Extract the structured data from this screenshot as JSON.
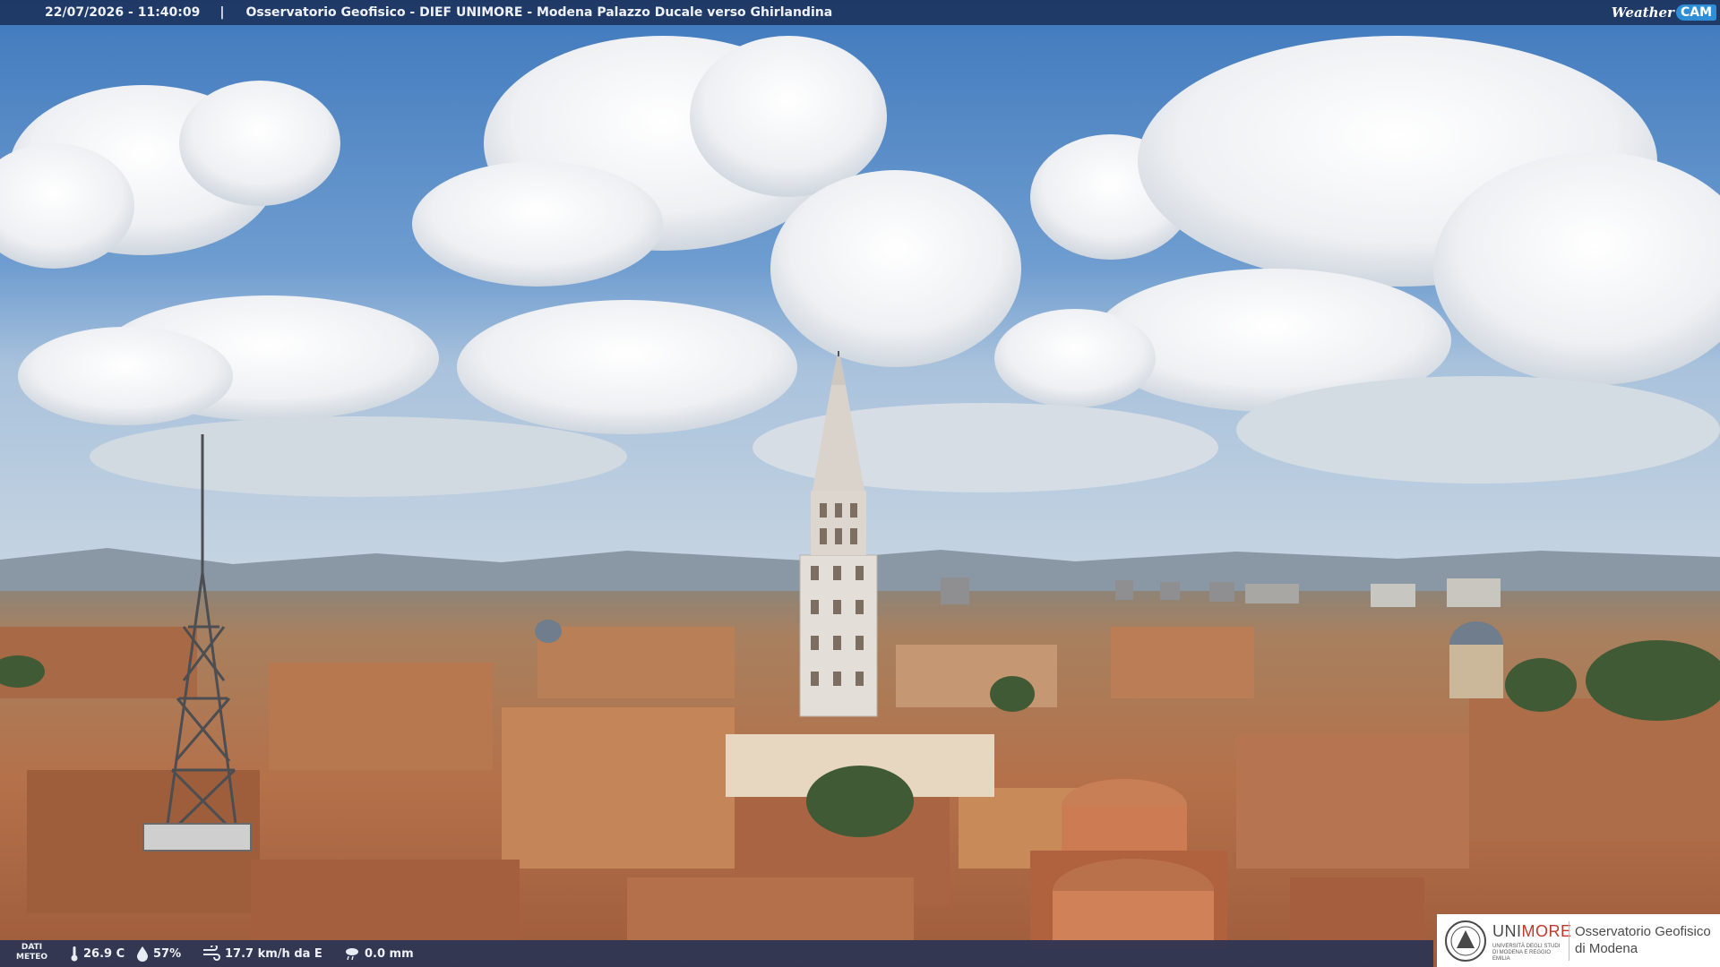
{
  "header": {
    "timestamp": "22/07/2026 - 11:40:09",
    "separator": "|",
    "caption": "Osservatorio Geofisico - DIEF UNIMORE - Modena Palazzo Ducale verso Ghirlandina"
  },
  "brand": {
    "weather": "Weather",
    "cam": "CAM"
  },
  "weather": {
    "tag_line1": "DATI",
    "tag_line2": "METEO",
    "temperature": "26.9 C",
    "humidity": "57%",
    "wind": "17.7 km/h da E",
    "rain": "0.0 mm"
  },
  "logo": {
    "uni": "UNI",
    "more": "MORE",
    "sub": "UNIVERSITÀ DEGLI STUDI DI MODENA E REGGIO EMILIA",
    "observatory_line1": "Osservatorio Geofisico",
    "observatory_line2": "di Modena"
  },
  "colors": {
    "sky": "#5a8fc8",
    "roof": "#b5744e",
    "overlay": "#1c2e56",
    "brand_accent": "#2f8fd6",
    "logo_red": "#c0392b"
  }
}
